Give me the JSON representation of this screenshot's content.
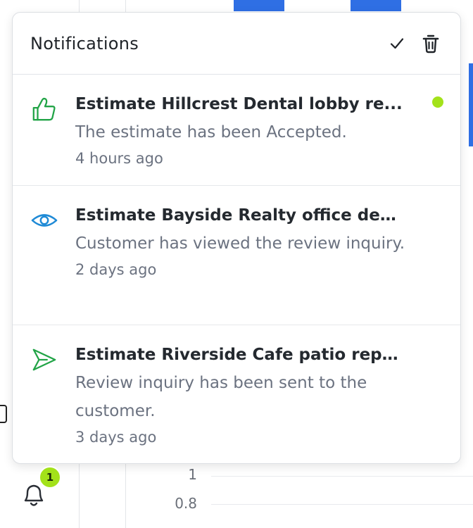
{
  "panel": {
    "title": "Notifications",
    "mark_all_read_icon": "checkmark-icon",
    "clear_all_icon": "trash-icon"
  },
  "notifications": [
    {
      "icon": "thumbs-up-icon",
      "icon_color": "#22a447",
      "title": "Estimate Hillcrest Dental lobby re...",
      "message": "The estimate has been Accepted.",
      "time": "4 hours ago",
      "unread": true
    },
    {
      "icon": "eye-icon",
      "icon_color": "#1f8ad6",
      "title": "Estimate Bayside Realty office deep ...",
      "message": "Customer has viewed the review inquiry.",
      "time": "2 days ago",
      "unread": false
    },
    {
      "icon": "send-icon",
      "icon_color": "#22a447",
      "title": "Estimate Riverside Cafe patio repaint...",
      "message": "Review inquiry has been sent to the customer.",
      "time": "3 days ago",
      "unread": false
    }
  ],
  "bell": {
    "icon": "bell-icon",
    "badge_count": "1",
    "badge_color": "#a3e21a"
  },
  "background": {
    "y_ticks": [
      "1",
      "0.8"
    ],
    "accent_color": "#2f6fe4"
  }
}
